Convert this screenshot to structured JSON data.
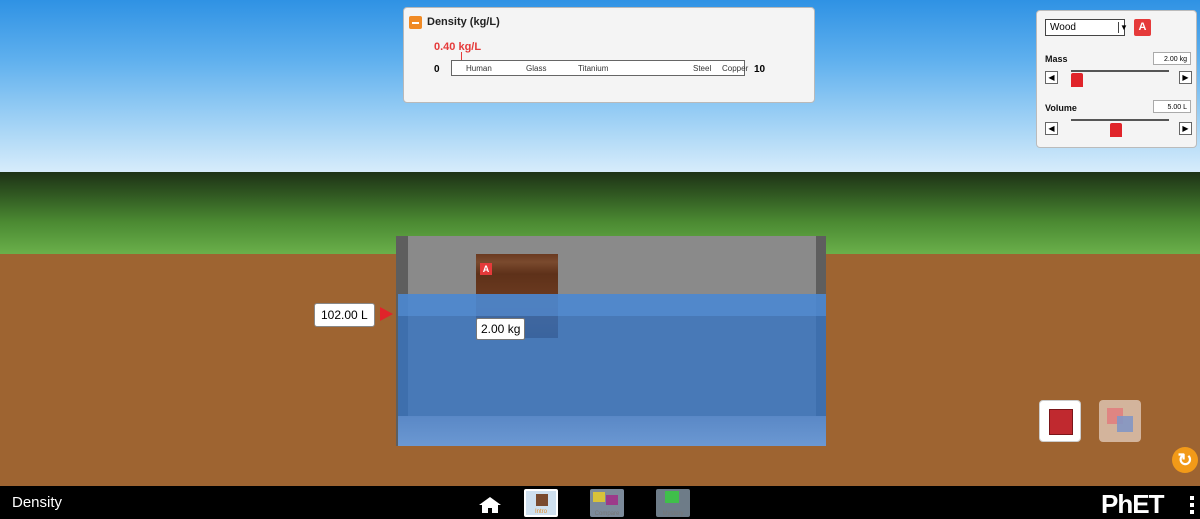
{
  "density_panel": {
    "title": "Density (kg/L)",
    "value": "0.40 kg/L",
    "min": "0",
    "max": "10",
    "markers": [
      "Human",
      "Glass",
      "Titanium",
      "Steel",
      "Copper"
    ]
  },
  "scene": {
    "volume_label": "102.00 L",
    "block_tag": "A",
    "block_mass_label": "2.00 kg"
  },
  "controls": {
    "material": "Wood",
    "badge": "A",
    "mass_label": "Mass",
    "mass_value": "2.00 kg",
    "volume_label": "Volume",
    "volume_value": "5.00 L",
    "mass_level": 0.06,
    "volume_level": 0.46
  },
  "nav": {
    "title": "Density",
    "screens": [
      "Intro",
      "Compare",
      "Mystery"
    ],
    "logo": "PhET"
  },
  "colors": {
    "accent": "#e53a3a",
    "orange": "#f29a18"
  }
}
